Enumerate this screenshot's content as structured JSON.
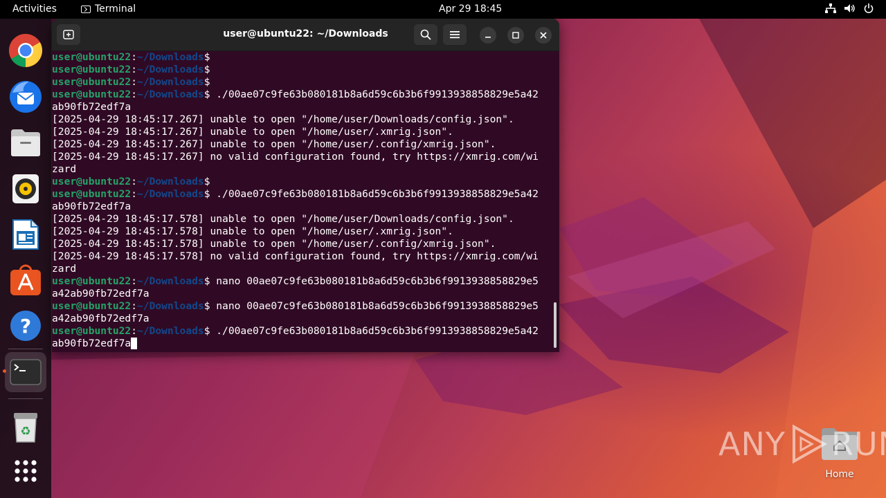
{
  "topbar": {
    "activities": "Activities",
    "app_name": "Terminal",
    "clock": "Apr 29  18:45"
  },
  "dock": {
    "items": [
      "chrome-icon",
      "thunderbird-icon",
      "files-icon",
      "rhythmbox-icon",
      "libreoffice-writer-icon",
      "app-center-icon",
      "help-icon",
      "terminal-icon",
      "trash-icon",
      "show-apps-icon"
    ]
  },
  "terminal": {
    "title": "user@ubuntu22: ~/Downloads",
    "prompt_user": "user@ubuntu22",
    "prompt_path": "~/Downloads",
    "lines": [
      {
        "type": "prompt",
        "cmd": ""
      },
      {
        "type": "prompt",
        "cmd": ""
      },
      {
        "type": "prompt",
        "cmd": ""
      },
      {
        "type": "prompt",
        "cmd": " ./00ae07c9fe63b080181b8a6d59c6b3b6f9913938858829e5a42"
      },
      {
        "type": "out",
        "text": "ab90fb72edf7a"
      },
      {
        "type": "out",
        "text": "[2025-04-29 18:45:17.267] unable to open \"/home/user/Downloads/config.json\"."
      },
      {
        "type": "out",
        "text": "[2025-04-29 18:45:17.267] unable to open \"/home/user/.xmrig.json\"."
      },
      {
        "type": "out",
        "text": "[2025-04-29 18:45:17.267] unable to open \"/home/user/.config/xmrig.json\"."
      },
      {
        "type": "out",
        "text": "[2025-04-29 18:45:17.267] no valid configuration found, try https://xmrig.com/wi"
      },
      {
        "type": "out",
        "text": "zard"
      },
      {
        "type": "prompt",
        "cmd": ""
      },
      {
        "type": "prompt",
        "cmd": " ./00ae07c9fe63b080181b8a6d59c6b3b6f9913938858829e5a42"
      },
      {
        "type": "out",
        "text": "ab90fb72edf7a"
      },
      {
        "type": "out",
        "text": "[2025-04-29 18:45:17.578] unable to open \"/home/user/Downloads/config.json\"."
      },
      {
        "type": "out",
        "text": "[2025-04-29 18:45:17.578] unable to open \"/home/user/.xmrig.json\"."
      },
      {
        "type": "out",
        "text": "[2025-04-29 18:45:17.578] unable to open \"/home/user/.config/xmrig.json\"."
      },
      {
        "type": "out",
        "text": "[2025-04-29 18:45:17.578] no valid configuration found, try https://xmrig.com/wi"
      },
      {
        "type": "out",
        "text": "zard"
      },
      {
        "type": "prompt",
        "cmd": " nano 00ae07c9fe63b080181b8a6d59c6b3b6f9913938858829e5"
      },
      {
        "type": "out",
        "text": "a42ab90fb72edf7a"
      },
      {
        "type": "prompt",
        "cmd": " nano 00ae07c9fe63b080181b8a6d59c6b3b6f9913938858829e5"
      },
      {
        "type": "out",
        "text": "a42ab90fb72edf7a"
      },
      {
        "type": "prompt",
        "cmd": " ./00ae07c9fe63b080181b8a6d59c6b3b6f9913938858829e5a42"
      },
      {
        "type": "out",
        "text": "ab90fb72edf7a",
        "cursor": true
      }
    ]
  },
  "desktop": {
    "home_label": "Home"
  },
  "watermark": {
    "left": "ANY",
    "right": "RUN"
  },
  "colors": {
    "accent": "#e95420",
    "terminal_bg": "#300a24",
    "prompt_user": "#26a269",
    "prompt_path": "#12488b"
  }
}
